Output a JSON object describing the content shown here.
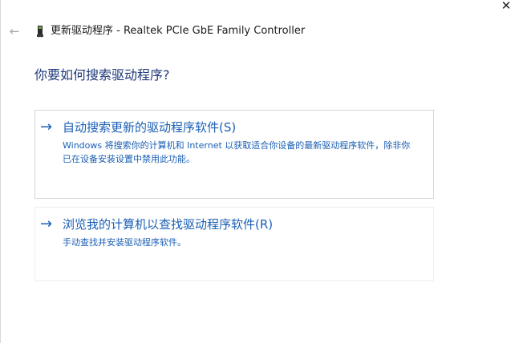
{
  "window": {
    "close_glyph": "✕",
    "back_glyph": "←",
    "title": "更新驱动程序 - Realtek PCIe GbE Family Controller",
    "device_icon": "device-icon"
  },
  "main": {
    "heading": "你要如何搜索驱动程序?",
    "options": [
      {
        "arrow": "→",
        "title": "自动搜索更新的驱动程序软件(S)",
        "description": "Windows 将搜索你的计算机和 Internet 以获取适合你设备的最新驱动程序软件，除非你已在设备安装设置中禁用此功能。"
      },
      {
        "arrow": "→",
        "title": "浏览我的计算机以查找驱动程序软件(R)",
        "description": "手动查找并安装驱动程序软件。"
      }
    ]
  },
  "colors": {
    "accent": "#1a5fb4",
    "heading": "#1f3a7a",
    "border": "#d6d6d6"
  }
}
